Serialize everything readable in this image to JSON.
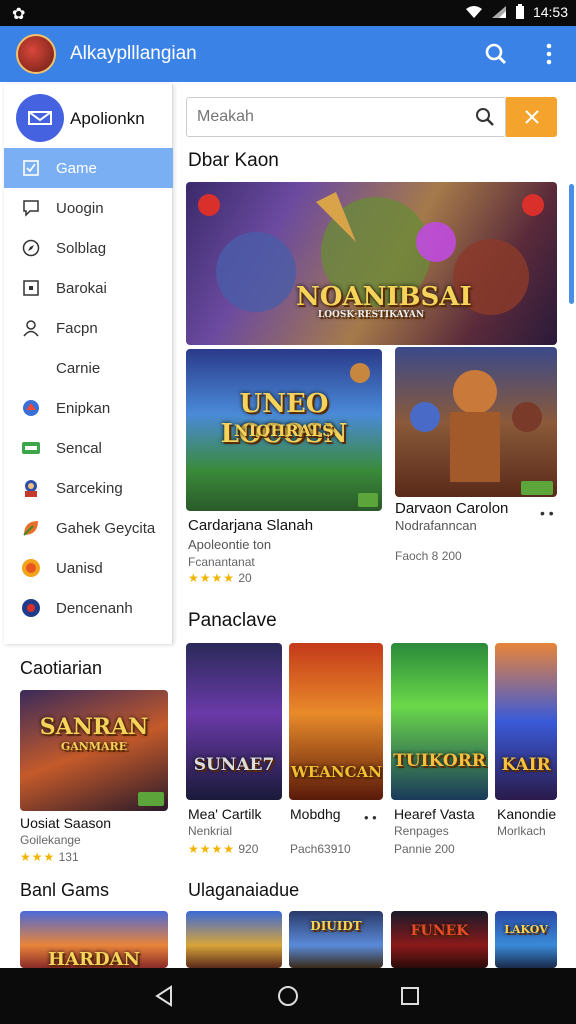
{
  "status_bar": {
    "time": "14:53"
  },
  "app_bar": {
    "title": "Alkayplllangian",
    "search_icon": "search-icon",
    "more_icon": "more-vert-icon"
  },
  "drawer": {
    "app_name": "Apolionkn",
    "items": [
      {
        "label": "Game",
        "icon": "checkbox-icon",
        "active": true
      },
      {
        "label": "Uoogin",
        "icon": "chat-icon"
      },
      {
        "label": "Solblag",
        "icon": "compass-icon"
      },
      {
        "label": "Barokai",
        "icon": "grid-icon"
      },
      {
        "label": "Facpn",
        "icon": "person-icon"
      },
      {
        "label": "Carnie",
        "icon": ""
      },
      {
        "label": "Enipkan",
        "icon": "game-icon"
      },
      {
        "label": "Sencal",
        "icon": "controller-icon"
      },
      {
        "label": "Sarceking",
        "icon": "character-icon"
      },
      {
        "label": "Gahek Geycita",
        "icon": "leaf-icon"
      },
      {
        "label": "Uanisd",
        "icon": "coin-icon"
      },
      {
        "label": "Dencenanh",
        "icon": "globe-icon"
      }
    ]
  },
  "search": {
    "placeholder": "Meakah",
    "value": ""
  },
  "sections": {
    "featured": "Dbar Kaon",
    "popular": "Panaclave",
    "left_list": "Caotiarian",
    "best_games": "Banl Gams",
    "upcoming": "Ulaganaiadue"
  },
  "featured": {
    "banner_title": "NOANIBSAI",
    "banner_sub": "LOOSK·RESTIKAYAN",
    "card1": {
      "art_title": "UNEO LOCOSN",
      "art_sub": "NIOHRALS",
      "title": "Cardarjana Slanah",
      "subtitle": "Apoleontie ton",
      "meta": "Fcanantanat",
      "stars": "★★★★",
      "rating": "20"
    },
    "card2": {
      "title": "Darvaon Carolon",
      "subtitle": "Nodrafanncan",
      "meta": "Faoch 8 200",
      "more": "• •"
    }
  },
  "left_card": {
    "art_title": "SANRAN",
    "art_sub": "GANMARE",
    "title": "Uosiat Saason",
    "subtitle": "Goilekange",
    "stars": "★★★",
    "rating": "131"
  },
  "popular": [
    {
      "art_title": "SUNAE7",
      "title": "Mea' Cartilk",
      "subtitle": "Nenkrial",
      "stars": "★★★★",
      "rating": "920"
    },
    {
      "art_title": "WEANCAN",
      "title": "Mobdhg",
      "subtitle": "",
      "meta": "Pach63910",
      "more": "• •"
    },
    {
      "art_title": "TUIKORR",
      "title": "Hearef Vasta",
      "subtitle": "Renpages",
      "meta": "Pannie 200"
    },
    {
      "art_title": "KAIR",
      "title": "Kanondie",
      "subtitle": "Morlkach"
    }
  ],
  "bottom_left_art": "HARDAN",
  "upcoming_arts": [
    "",
    "DIUIDT",
    "FUNEK",
    "LAKOV"
  ],
  "nav": {
    "back": "back-icon",
    "home": "home-icon",
    "recents": "recents-icon"
  }
}
